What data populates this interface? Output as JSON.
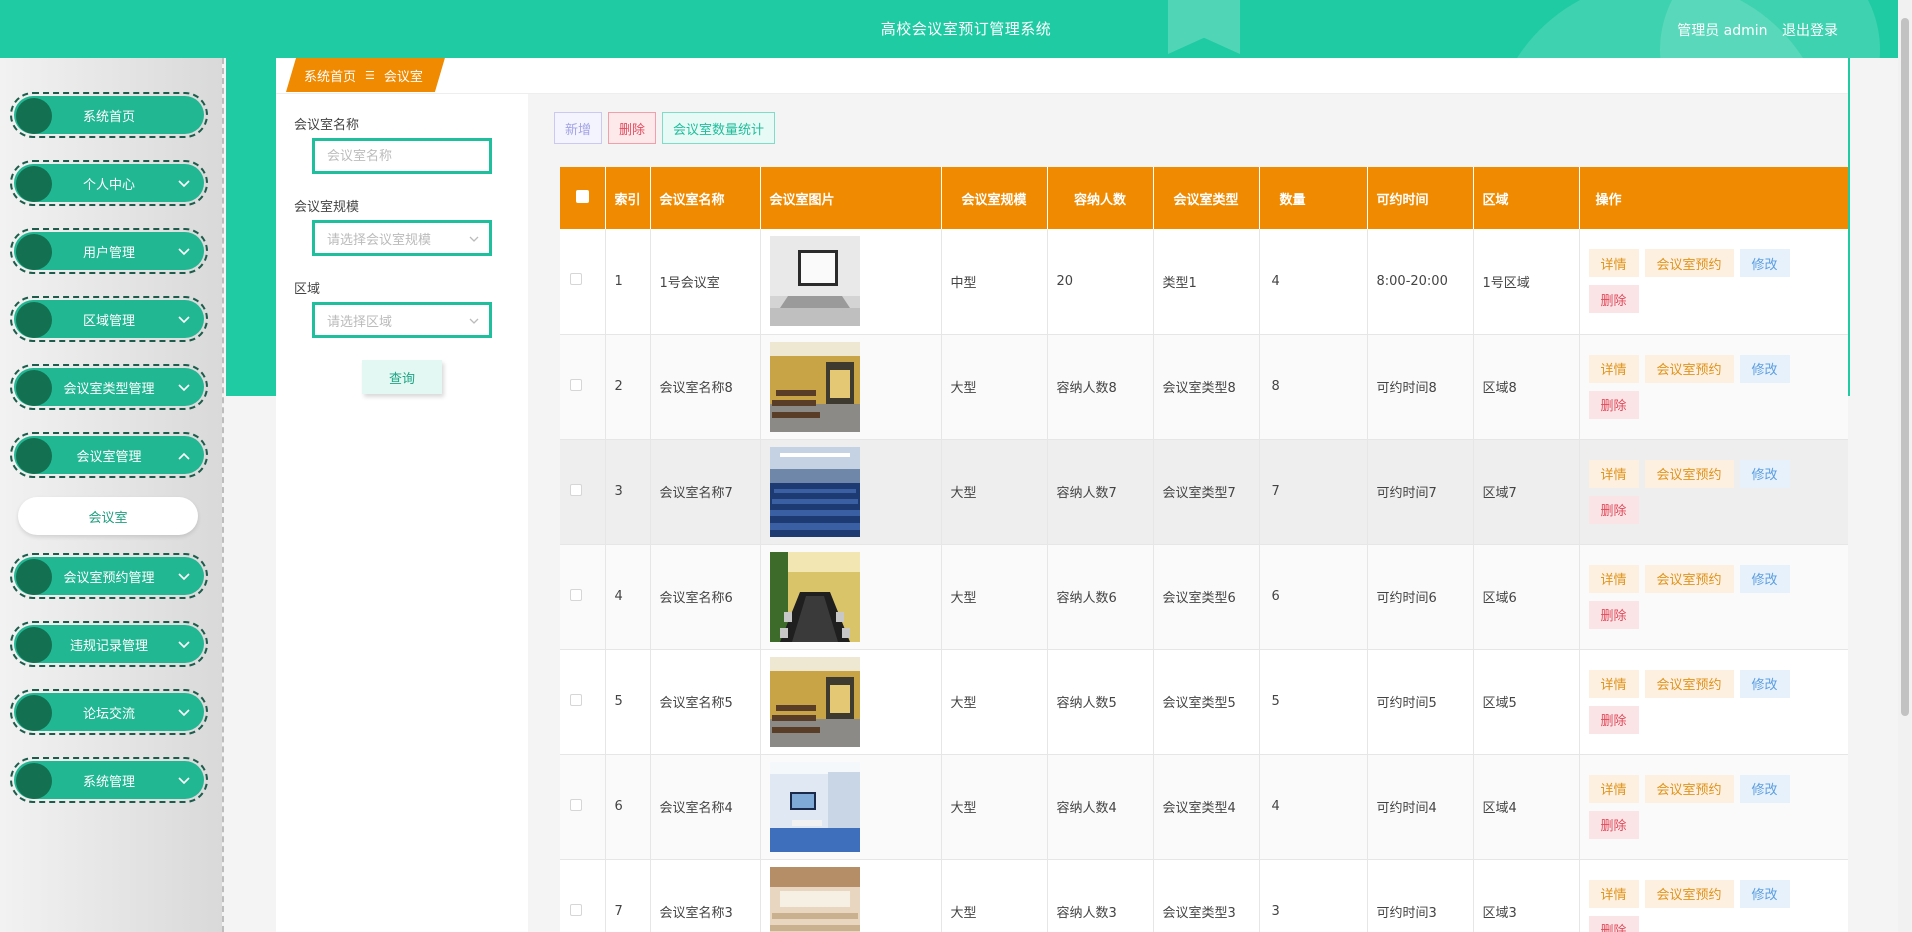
{
  "header": {
    "title": "高校会议室预订管理系统",
    "user_label": "管理员 admin",
    "logout_label": "退出登录"
  },
  "sidebar": {
    "items": [
      {
        "label": "系统首页",
        "expandable": false
      },
      {
        "label": "个人中心",
        "expandable": true
      },
      {
        "label": "用户管理",
        "expandable": true
      },
      {
        "label": "区域管理",
        "expandable": true
      },
      {
        "label": "会议室类型管理",
        "expandable": true
      },
      {
        "label": "会议室管理",
        "expandable": true,
        "expanded": true
      },
      {
        "label": "会议室预约管理",
        "expandable": true
      },
      {
        "label": "违规记录管理",
        "expandable": true
      },
      {
        "label": "论坛交流",
        "expandable": true
      },
      {
        "label": "系统管理",
        "expandable": true
      }
    ],
    "submenu": {
      "label": "会议室"
    }
  },
  "breadcrumb": {
    "home": "系统首页",
    "separator": "☰",
    "current": "会议室"
  },
  "search": {
    "name_label": "会议室名称",
    "name_placeholder": "会议室名称",
    "scale_label": "会议室规模",
    "scale_placeholder": "请选择会议室规模",
    "area_label": "区域",
    "area_placeholder": "请选择区域",
    "query_label": "查询"
  },
  "toolbar": {
    "add_label": "新增",
    "delete_label": "删除",
    "stat_label": "会议室数量统计"
  },
  "table": {
    "headers": [
      "",
      "索引",
      "会议室名称",
      "会议室图片",
      "会议室规模",
      "容纳人数",
      "会议室类型",
      "数量",
      "可约时间",
      "区域",
      "操作"
    ],
    "actions": {
      "detail": "详情",
      "book": "会议室预约",
      "edit": "修改",
      "delete": "删除"
    },
    "rows": [
      {
        "index": "1",
        "name": "1号会议室",
        "scale": "中型",
        "capacity": "20",
        "type": "类型1",
        "count": "4",
        "time": "8:00-20:00",
        "area": "1号区域",
        "image": "laptop-desk"
      },
      {
        "index": "2",
        "name": "会议室名称8",
        "scale": "大型",
        "capacity": "容纳人数8",
        "type": "会议室类型8",
        "count": "8",
        "time": "可约时间8",
        "area": "区域8",
        "image": "classroom-yellow"
      },
      {
        "index": "3",
        "name": "会议室名称7",
        "scale": "大型",
        "capacity": "容纳人数7",
        "type": "会议室类型7",
        "count": "7",
        "time": "可约时间7",
        "area": "区域7",
        "image": "auditorium-blue"
      },
      {
        "index": "4",
        "name": "会议室名称6",
        "scale": "大型",
        "capacity": "容纳人数6",
        "type": "会议室类型6",
        "count": "6",
        "time": "可约时间6",
        "area": "区域6",
        "image": "boardroom-long-table"
      },
      {
        "index": "5",
        "name": "会议室名称5",
        "scale": "大型",
        "capacity": "容纳人数5",
        "type": "会议室类型5",
        "count": "5",
        "time": "可约时间5",
        "area": "区域5",
        "image": "classroom-yellow"
      },
      {
        "index": "6",
        "name": "会议室名称4",
        "scale": "大型",
        "capacity": "容纳人数4",
        "type": "会议室类型4",
        "count": "4",
        "time": "可约时间4",
        "area": "区域4",
        "image": "meeting-room-screen"
      },
      {
        "index": "7",
        "name": "会议室名称3",
        "scale": "大型",
        "capacity": "容纳人数3",
        "type": "会议室类型3",
        "count": "3",
        "time": "可约时间3",
        "area": "区域3",
        "image": "hall-seats"
      }
    ]
  },
  "colors": {
    "primary": "#1fcba3",
    "sidebar_pill": "#22b793",
    "accent_orange": "#f08a00"
  }
}
